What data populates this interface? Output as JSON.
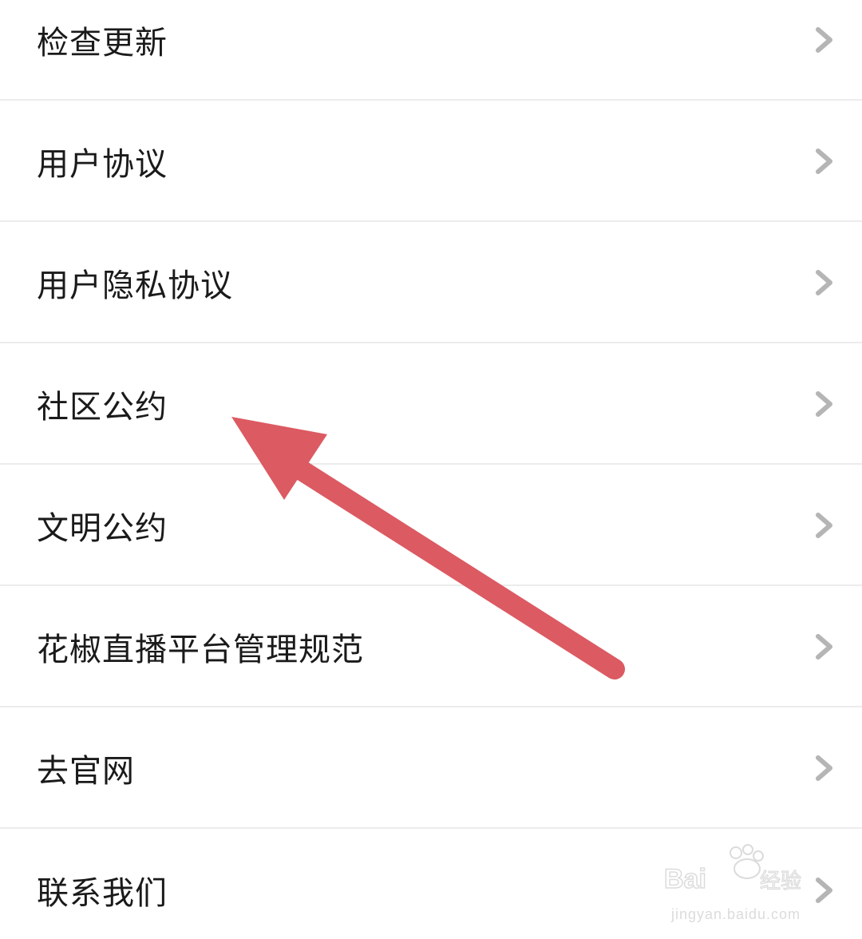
{
  "menu": {
    "items": [
      {
        "label": "检查更新",
        "icon": "chevron-right-icon"
      },
      {
        "label": "用户协议",
        "icon": "chevron-right-icon"
      },
      {
        "label": "用户隐私协议",
        "icon": "chevron-right-icon"
      },
      {
        "label": "社区公约",
        "icon": "chevron-right-icon"
      },
      {
        "label": "文明公约",
        "icon": "chevron-right-icon"
      },
      {
        "label": "花椒直播平台管理规范",
        "icon": "chevron-right-icon"
      },
      {
        "label": "去官网",
        "icon": "chevron-right-icon"
      },
      {
        "label": "联系我们",
        "icon": "chevron-right-icon"
      }
    ]
  },
  "annotation": {
    "arrow_color": "#dc5a62",
    "icon": "arrow-annotation-icon"
  },
  "watermark": {
    "brand": "Bai du 经验",
    "url": "jingyan.baidu.com",
    "icon": "baidu-paw-icon"
  },
  "colors": {
    "text": "#1a1a1a",
    "chevron": "#b5b5b5",
    "divider": "#ececec",
    "background": "#ffffff"
  }
}
